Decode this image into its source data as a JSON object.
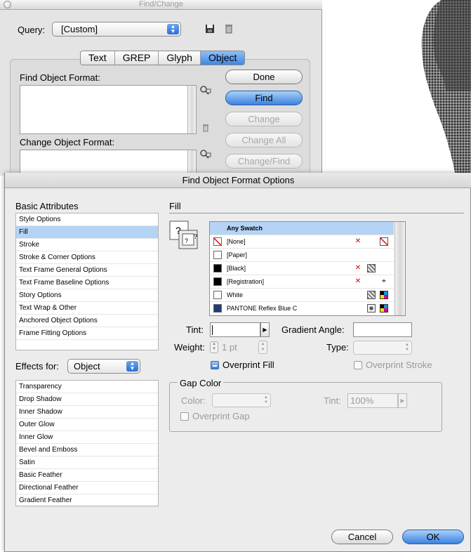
{
  "find_change": {
    "title": "Find/Change",
    "query_label": "Query:",
    "query_value": "[Custom]",
    "tabs": [
      {
        "label": "Text",
        "selected": false
      },
      {
        "label": "GREP",
        "selected": false
      },
      {
        "label": "Glyph",
        "selected": false
      },
      {
        "label": "Object",
        "selected": true
      }
    ],
    "find_label": "Find Object Format:",
    "change_label": "Change Object Format:",
    "buttons": {
      "done": "Done",
      "find": "Find",
      "change": "Change",
      "change_all": "Change All",
      "change_find": "Change/Find"
    }
  },
  "dialog": {
    "title": "Find Object Format Options",
    "basic_attributes_header": "Basic Attributes",
    "basic_attributes": [
      {
        "label": "Style Options",
        "selected": false
      },
      {
        "label": "Fill",
        "selected": true
      },
      {
        "label": "Stroke",
        "selected": false
      },
      {
        "label": "Stroke & Corner Options",
        "selected": false
      },
      {
        "label": "Text Frame General Options",
        "selected": false
      },
      {
        "label": "Text Frame Baseline Options",
        "selected": false
      },
      {
        "label": "Story Options",
        "selected": false
      },
      {
        "label": "Text Wrap & Other",
        "selected": false
      },
      {
        "label": "Anchored Object Options",
        "selected": false
      },
      {
        "label": "Frame Fitting Options",
        "selected": false
      }
    ],
    "effects_for_label": "Effects for:",
    "effects_for_value": "Object",
    "effects": [
      {
        "label": "Transparency"
      },
      {
        "label": "Drop Shadow"
      },
      {
        "label": "Inner Shadow"
      },
      {
        "label": "Outer Glow"
      },
      {
        "label": "Inner Glow"
      },
      {
        "label": "Bevel and Emboss"
      },
      {
        "label": "Satin"
      },
      {
        "label": "Basic Feather"
      },
      {
        "label": "Directional Feather"
      },
      {
        "label": "Gradient Feather"
      }
    ],
    "section_title": "Fill",
    "swatches": [
      {
        "name": "Any Swatch",
        "chip": "none",
        "selected": true
      },
      {
        "name": "[None]",
        "chip": "none-slash",
        "selected": false
      },
      {
        "name": "[Paper]",
        "chip": "#ffffff",
        "selected": false
      },
      {
        "name": "[Black]",
        "chip": "#000000",
        "selected": false
      },
      {
        "name": "[Registration]",
        "chip": "#000000",
        "selected": false
      },
      {
        "name": "White",
        "chip": "#ffffff",
        "selected": false
      },
      {
        "name": "PANTONE Reflex Blue C",
        "chip": "#203a7a",
        "selected": false
      }
    ],
    "tint_label": "Tint:",
    "tint_value": "",
    "gradient_angle_label": "Gradient Angle:",
    "gradient_angle_value": "",
    "weight_label": "Weight:",
    "weight_value": "1 pt",
    "type_label": "Type:",
    "type_value": "",
    "overprint_fill_label": "Overprint Fill",
    "overprint_stroke_label": "Overprint Stroke",
    "gap_color_title": "Gap Color",
    "gap_color_label": "Color:",
    "gap_color_value": "",
    "gap_tint_label": "Tint:",
    "gap_tint_value": "100%",
    "overprint_gap_label": "Overprint Gap",
    "cancel_label": "Cancel",
    "ok_label": "OK"
  },
  "colors": {
    "accent": "#3b82e0",
    "selection": "#b5d3f5"
  }
}
